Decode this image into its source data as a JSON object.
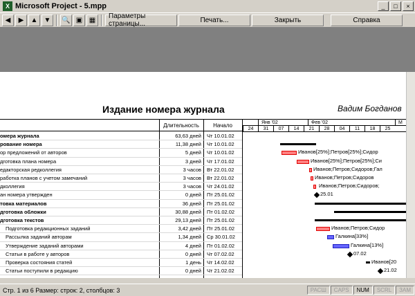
{
  "window": {
    "title": "Microsoft Project - 5.mpp",
    "app_icon": "X"
  },
  "toolbar": {
    "page_setup": "Параметры страницы...",
    "print": "Печать...",
    "close": "Закрыть",
    "help": "Справка"
  },
  "doc": {
    "title": "Издание номера журнала",
    "author": "Вадим Богданов"
  },
  "table": {
    "headers": {
      "duration": "Длительность",
      "start": "Начало"
    },
    "rows": [
      {
        "name": "омера журнала",
        "dur": "63,63 дней",
        "start": "Чт 10.01.02",
        "bold": true
      },
      {
        "name": "рование номера",
        "dur": "11,38 дней",
        "start": "Чт 10.01.02",
        "bold": true
      },
      {
        "name": "ор предложений от авторов",
        "dur": "5 дней",
        "start": "Чт 10.01.02"
      },
      {
        "name": "дготовка плана номера",
        "dur": "3 дней",
        "start": "Чт 17.01.02"
      },
      {
        "name": "едакторская редколлегия",
        "dur": "3 часов",
        "start": "Вт 22.01.02"
      },
      {
        "name": "работка планов с учетом замечаний",
        "dur": "3 часов",
        "start": "Вт 22.01.02"
      },
      {
        "name": "дколлегия",
        "dur": "3 часов",
        "start": "Чт 24.01.02"
      },
      {
        "name": "ан номера утвержден",
        "dur": "0 дней",
        "start": "Пт 25.01.02"
      },
      {
        "name": "товка материалов",
        "dur": "36 дней",
        "start": "Пт 25.01.02",
        "bold": true
      },
      {
        "name": "дготовка обложки",
        "dur": "30,88 дней",
        "start": "Пт 01.02.02",
        "bold": true
      },
      {
        "name": "дготовка текстов",
        "dur": "29,13 дней",
        "start": "Пт 25.01.02",
        "bold": true
      },
      {
        "name": "Подготовка редакционных заданий",
        "dur": "3,42 дней",
        "start": "Пт 25.01.02"
      },
      {
        "name": "Рассылка заданий авторам",
        "dur": "1,34 дней",
        "start": "Ср 30.01.02"
      },
      {
        "name": "Утверждение заданий авторами",
        "dur": "4 дней",
        "start": "Пт 01.02.02"
      },
      {
        "name": "Статьи в работе у авторов",
        "dur": "0 дней",
        "start": "Чт 07.02.02"
      },
      {
        "name": "Проверка состояния статей",
        "dur": "1 день",
        "start": "Чт 14.02.02"
      },
      {
        "name": "Статьи поступили в редакцию",
        "dur": "0 дней",
        "start": "Чт 21.02.02"
      }
    ]
  },
  "gantt": {
    "months": [
      "Янв '02",
      "Фев '02",
      "М"
    ],
    "days": [
      "24",
      "31",
      "07",
      "14",
      "21",
      "28",
      "04",
      "11",
      "18",
      "25"
    ],
    "labels": {
      "r2": "Иванов[25%];Петров[25%];Сидор",
      "r3": "Иванов[25%];Петров[25%];Си",
      "r4": "Иванов;Петров;Сидоров;Гал",
      "r5": "Иванов;Петров;Сидоров",
      "r6": "Иванов;Петров;Сидоров;",
      "r7": "25.01",
      "r11": "Иванов;Петров;Сидор",
      "r12": "Галкина[33%]",
      "r13": "Галкина[13%]",
      "r14": "07.02",
      "r15": "Иванов[20",
      "r16": "21.02"
    }
  },
  "status": {
    "main": "Стр. 1 из 6  Размер: строк: 2, столбцов: 3",
    "ind": [
      "РАСШ",
      "CAPS",
      "NUM",
      "SCRL",
      "ЗАМ"
    ]
  },
  "colors": {
    "task": "#ff8080",
    "critical": "#e00000",
    "blue_task": "#6666ff",
    "summary": "#000000"
  }
}
